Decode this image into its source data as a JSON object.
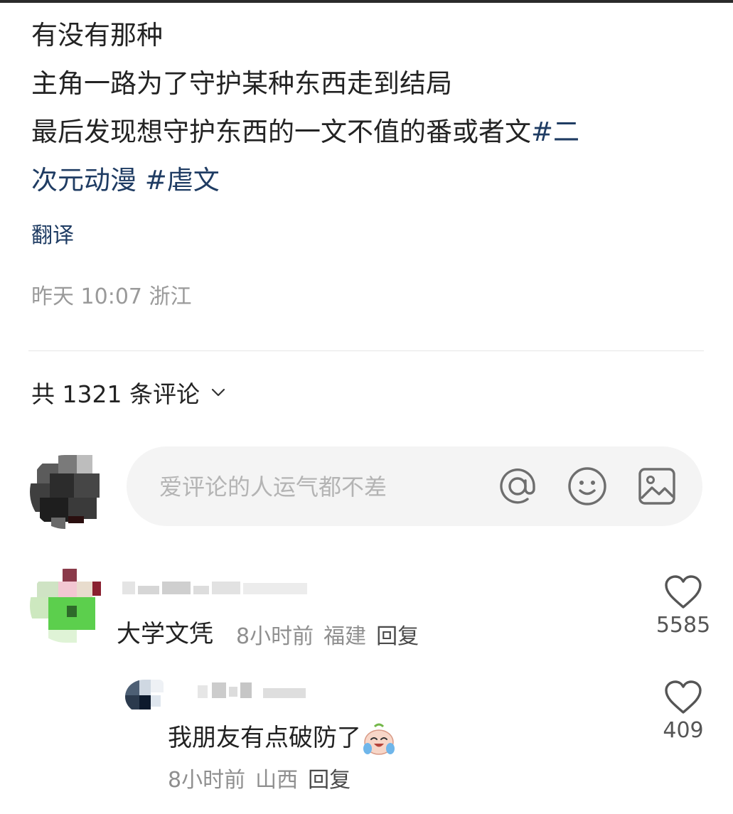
{
  "post": {
    "lines": [
      {
        "text": "有没有那种"
      },
      {
        "text": "主角一路为了守护某种东西走到结局"
      },
      {
        "text": "最后发现想守护东西的一文不值的番或者文",
        "tag": "#二"
      },
      {
        "text": "",
        "tag": "次元动漫 #虐文"
      }
    ],
    "line4_plain": "次元动漫 ",
    "line4_tag": "#虐文"
  },
  "translate_label": "翻译",
  "meta": {
    "time": "昨天 10:07",
    "location": "浙江"
  },
  "comments_header": {
    "label": "共 1321 条评论"
  },
  "composer": {
    "placeholder": "爱评论的人运气都不差"
  },
  "icons": {
    "mention": "at-icon",
    "emoji": "smiley-icon",
    "image": "image-icon",
    "chevron": "chevron-down-icon",
    "like": "heart-outline-icon",
    "crying_laugh": "crying-laughing-emoji"
  },
  "colors": {
    "hashtag": "#1f3c63",
    "meta": "#9a9a9a",
    "composer_bg": "#f4f4f4"
  },
  "comments": [
    {
      "text": "大学文凭",
      "time": "8小时前",
      "location": "福建",
      "reply": "回复",
      "likes": "5585"
    },
    {
      "text": "我朋友有点破防了",
      "time": "8小时前",
      "location": "山西",
      "reply": "回复",
      "likes": "409"
    }
  ]
}
